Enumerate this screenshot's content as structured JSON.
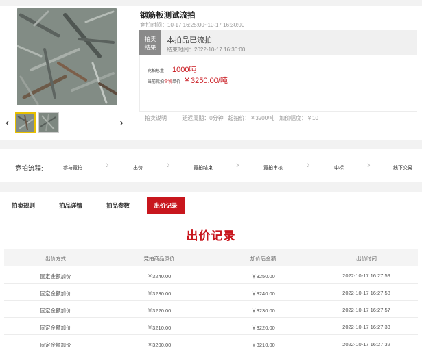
{
  "product": {
    "title": "钢筋板测试流拍",
    "time": "竞拍时间：10-17 16:25:00~10-17 16:30:00",
    "result_tag_line1": "拍卖",
    "result_tag_line2": "结果",
    "result_text": "本拍品已流拍",
    "end_time": "结束时间：2022-10-17 16:30:00",
    "qty_label": "竞拍总量：",
    "qty_value": "1000吨",
    "price_label_a": "当前竞拍",
    "price_label_b": "含税",
    "price_label_c": "单价",
    "price_value": "￥3250.00/吨",
    "explain_label": "拍卖说明",
    "explain_delay": "延迟周期：0分钟",
    "explain_start": "起拍价：￥3200/吨",
    "explain_step": "加价幅度：￥10",
    "arrow_left": "‹",
    "arrow_right": "›"
  },
  "process": {
    "label": "竞拍流程:",
    "chevron": "›",
    "steps": [
      "参与竞拍",
      "出价",
      "竞拍结束",
      "竞拍审核",
      "中标",
      "线下交易"
    ]
  },
  "tabs": {
    "items": [
      "拍卖规则",
      "拍品详情",
      "拍品参数",
      "出价记录"
    ],
    "active": "出价记录"
  },
  "records": {
    "title": "出价记录",
    "headers": [
      "出价方式",
      "竞拍商品原价",
      "加价后金额",
      "出价时间"
    ],
    "rows": [
      [
        "固定金额加价",
        "￥3240.00",
        "￥3250.00",
        "2022-10-17 16:27:59"
      ],
      [
        "固定金额加价",
        "￥3230.00",
        "￥3240.00",
        "2022-10-17 16:27:58"
      ],
      [
        "固定金额加价",
        "￥3220.00",
        "￥3230.00",
        "2022-10-17 16:27:57"
      ],
      [
        "固定金额加价",
        "￥3210.00",
        "￥3220.00",
        "2022-10-17 16:27:33"
      ],
      [
        "固定金额加价",
        "￥3200.00",
        "￥3210.00",
        "2022-10-17 16:27:32"
      ]
    ]
  },
  "colors": {
    "accent": "#c8161d",
    "tag_gray": "#8a8a8a"
  }
}
